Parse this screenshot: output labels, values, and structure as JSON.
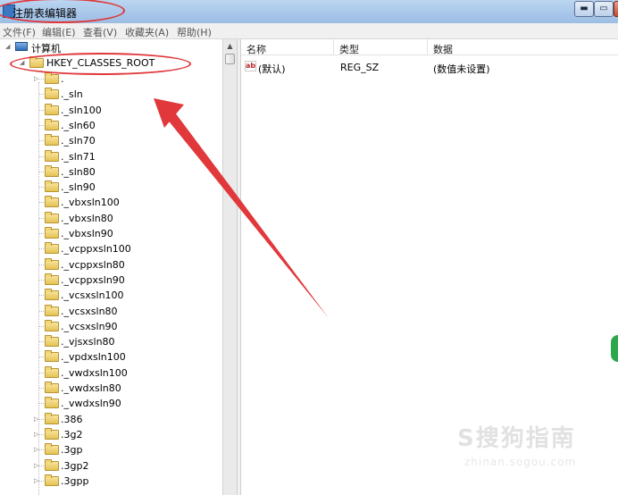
{
  "window": {
    "title": "注册表编辑器",
    "controls": {
      "minimize": "▬",
      "maximize": "▭",
      "close": ""
    }
  },
  "menubar": [
    "文件(F)",
    "编辑(E)",
    "查看(V)",
    "收藏夹(A)",
    "帮助(H)"
  ],
  "tree": {
    "root": "计算机",
    "expanded": "HKEY_CLASSES_ROOT",
    "children": [
      ".",
      "._sln",
      "._sln100",
      "._sln60",
      "._sln70",
      "._sln71",
      "._sln80",
      "._sln90",
      "._vbxsln100",
      "._vbxsln80",
      "._vbxsln90",
      "._vcppxsln100",
      "._vcppxsln80",
      "._vcppxsln90",
      "._vcsxsln100",
      "._vcsxsln80",
      "._vcsxsln90",
      "._vjsxsln80",
      "._vpdxsln100",
      "._vwdxsln100",
      "._vwdxsln80",
      "._vwdxsln90",
      ".386",
      ".3g2",
      ".3gp",
      ".3gp2",
      ".3gpp"
    ]
  },
  "list": {
    "columns": [
      "名称",
      "类型",
      "数据"
    ],
    "rows": [
      {
        "icon": "ab",
        "name": "(默认)",
        "type": "REG_SZ",
        "data": "(数值未设置)"
      }
    ]
  },
  "watermark": {
    "brand": "S搜狗指南",
    "url": "zhinan.sogou.com"
  },
  "colors": {
    "annotation": "#e0383b",
    "titlebar": "#a9c7ea",
    "folder": "#e4c255"
  }
}
